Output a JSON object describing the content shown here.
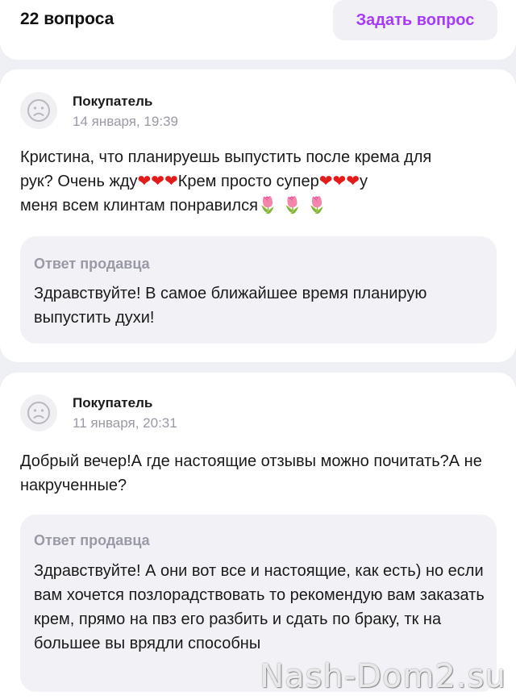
{
  "header": {
    "questions_count": "22 вопроса",
    "ask_button": "Задать вопрос",
    "accent_color": "#a73afd"
  },
  "questions": [
    {
      "avatar_icon": "sad-face-icon",
      "author": "Покупатель",
      "date": "14 января, 19:39",
      "text": "Кристина, что планируешь выпустить после крема для рук? Очень жду❤️❤️❤️Крем просто супер❤️❤️❤️у меня всем клинтам понравился🌷🌷🌷",
      "text_line1": "Кристина, что планируешь выпустить после крема для",
      "text_line2_a": "рук? Очень жду",
      "text_line2_hearts_a": "❤❤❤",
      "text_line2_b": "Крем просто супер",
      "text_line2_hearts_b": "❤❤❤",
      "text_line2_c": "у",
      "text_line3": "меня всем клинтам понравился",
      "text_line3_flowers": "🌷 🌷 🌷",
      "answer_label": "Ответ продавца",
      "answer": "Здравствуйте! В самое ближайшее время планирую выпустить духи!"
    },
    {
      "avatar_icon": "sad-face-icon",
      "author": "Покупатель",
      "date": "11 января, 20:31",
      "text": "Добрый вечер!А где настоящие отзывы можно почитать?А не накрученные?",
      "answer_label": "Ответ продавца",
      "answer": "Здравствуйте! А они вот все и настоящие, как есть) но если вам хочется позлорадствовать то рекомендую вам заказать крем, прямо на пвз его разбить и сдать по браку, тк на большее вы врядли способны"
    }
  ],
  "watermark": "Nash-Dom2.su"
}
